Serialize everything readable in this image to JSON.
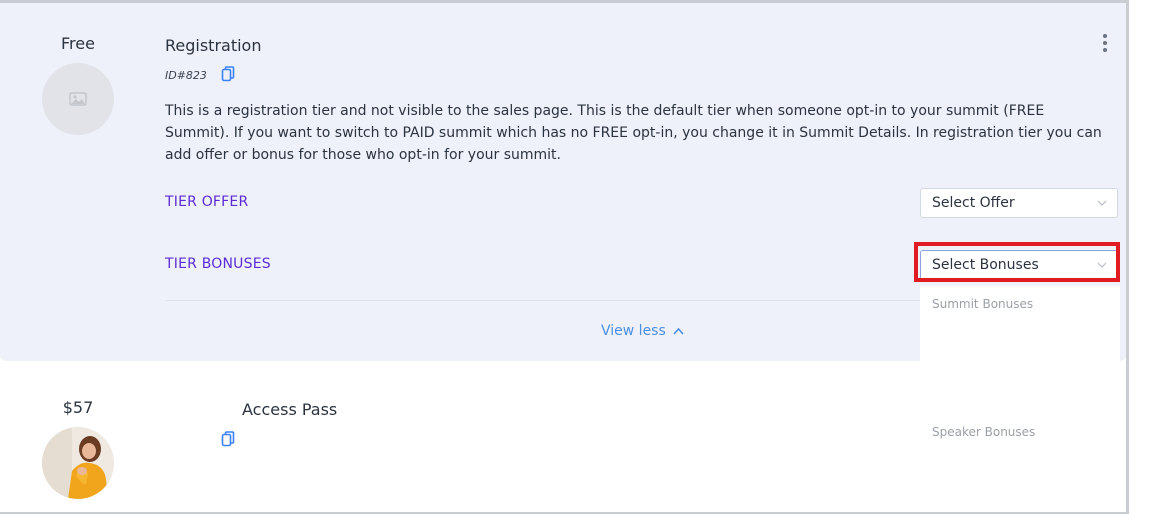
{
  "tiers": [
    {
      "price": "Free",
      "name": "Registration",
      "id_label": "ID#823",
      "description": "This is a registration tier and not visible to the sales page. This is the default tier when someone opt-in to your summit (FREE Summit). If you want to switch to PAID summit which has no FREE opt-in, you change it in Summit Details. In registration tier you can add offer or bonus for those who opt-in for your summit.",
      "offer_label": "TIER OFFER",
      "offer_select": "Select Offer",
      "bonus_label": "TIER BONUSES",
      "bonus_select": "Select Bonuses",
      "toggle_text": "View less",
      "thumbnail": "image-placeholder-icon"
    },
    {
      "price": "$57",
      "name": "Access Pass",
      "thumbnail": "person-photo"
    }
  ],
  "bonus_dropdown": {
    "groups": [
      "Summit Bonuses",
      "Speaker Bonuses"
    ]
  },
  "colors": {
    "accent_purple": "#5b2bd6",
    "link_blue": "#4a90e2",
    "highlight_red": "#e11b22",
    "panel_bg": "#eef1f9"
  }
}
